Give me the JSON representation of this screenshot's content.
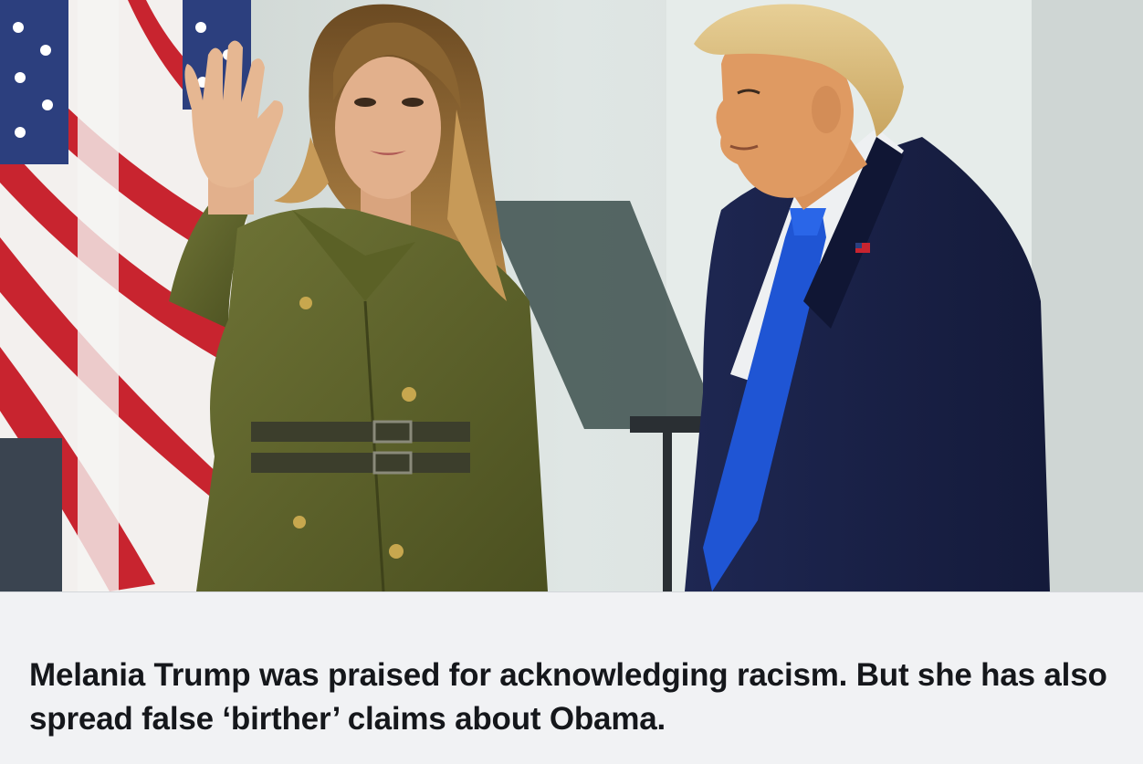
{
  "card": {
    "image_alt": "",
    "headline": "Melania Trump was praised for acknowledging racism. But she has also spread false ‘birther’ claims about Obama."
  },
  "colors": {
    "background": "#f1f2f4",
    "headline_text": "#15171b"
  }
}
